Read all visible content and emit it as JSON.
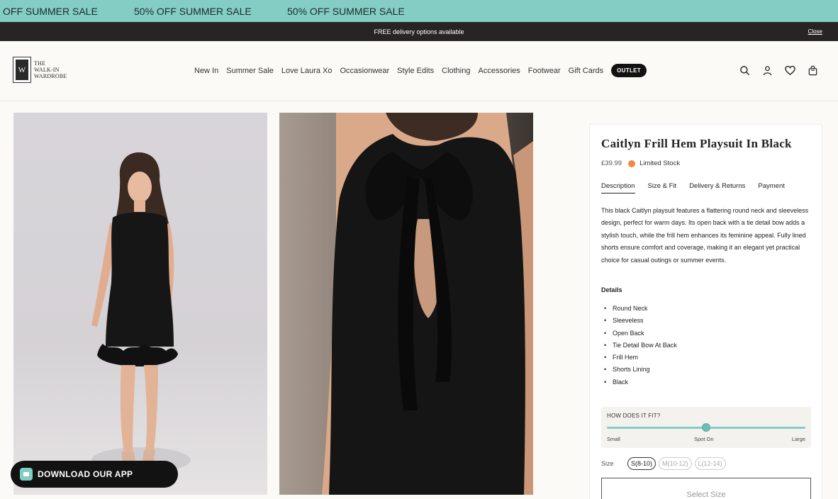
{
  "ticker": {
    "items": [
      "OFF SUMMER SALE",
      "50% OFF SUMMER SALE",
      "50% OFF SUMMER SALE"
    ]
  },
  "announcement": {
    "text": "FREE delivery options available",
    "close_label": "Close"
  },
  "logo": {
    "mark": "W",
    "line1": "THE",
    "line2": "WALK-IN",
    "line3": "WARDROBE"
  },
  "nav": {
    "items": [
      "New In",
      "Summer Sale",
      "Love Laura Xo",
      "Occasionwear",
      "Style Edits",
      "Clothing",
      "Accessories",
      "Footwear",
      "Gift Cards"
    ],
    "outlet_label": "OUTLET"
  },
  "header_icons": [
    "search-icon",
    "account-icon",
    "wishlist-heart-icon",
    "bag-icon"
  ],
  "colors": {
    "ticker_bg": "#83cdc5",
    "announcement_bg": "#292424",
    "stock_dot": "#f08a4b",
    "page_bg": "#fbfaf6"
  },
  "product": {
    "title": "Caitlyn Frill Hem Playsuit In Black",
    "price": "£39.99",
    "stock_status": "Limited Stock",
    "tabs": [
      "Description",
      "Size & Fit",
      "Delivery & Returns",
      "Payment"
    ],
    "active_tab": "Description",
    "description": "This black Caitlyn playsuit features a flattering round neck and sleeveless design, perfect for warm days. Its open back with a tie detail bow adds a stylish touch, while the frill hem enhances its feminine appeal. Fully lined shorts ensure comfort and coverage, making it an elegant yet practical choice for casual outings or summer events.",
    "details_heading": "Details",
    "details": [
      "Round Neck",
      "Sleeveless",
      "Open Back",
      "Tie Detail Bow At Back",
      "Frill Hem",
      "Shorts Lining",
      "Black"
    ]
  },
  "fit": {
    "heading": "HOW DOES IT FIT?",
    "left_label": "Small",
    "middle_label": "Spot On",
    "right_label": "Large",
    "level": 0.5
  },
  "size": {
    "label": "Size",
    "options": [
      "S(8-10)",
      "M(10-12)",
      "L(12-14)"
    ],
    "selected": "S(8-10)",
    "select_button": "Select Size"
  },
  "app_banner": {
    "text": "DOWNLOAD OUR APP"
  }
}
